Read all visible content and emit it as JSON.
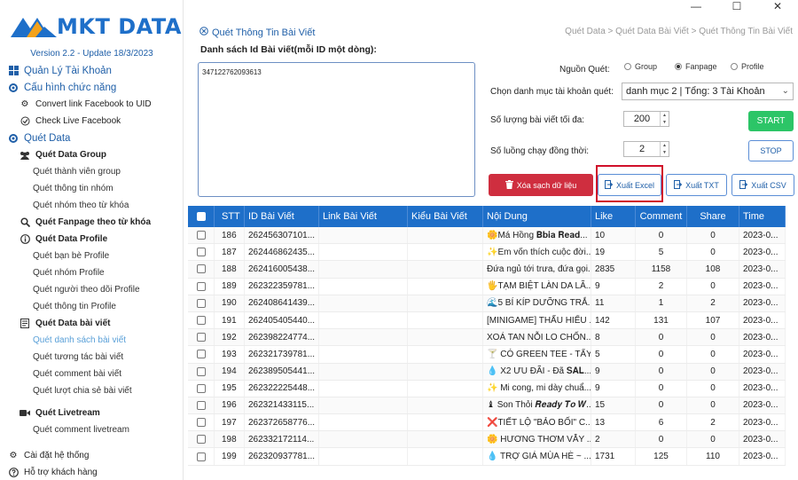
{
  "window": {
    "minimize": "—",
    "maximize": "☐",
    "close": "✕"
  },
  "brand": {
    "name": "MKT DATA",
    "version": "Version 2.2 - Update 18/3/2023"
  },
  "sidebar": {
    "items": [
      {
        "label": "Quản Lý Tài Khoản",
        "icon": "account-icon"
      },
      {
        "label": "Cấu hình chức năng",
        "icon": "config-icon"
      },
      {
        "label": "Convert link Facebook to UID",
        "icon": "gear-icon"
      },
      {
        "label": "Check Live Facebook",
        "icon": "check-icon"
      },
      {
        "label": "Quét Data",
        "icon": "config-icon"
      },
      {
        "label": "Quét Data Group",
        "icon": "group-icon"
      },
      {
        "label": "Quét thành viên group"
      },
      {
        "label": "Quét thông tin nhóm"
      },
      {
        "label": "Quét nhóm theo từ khóa"
      },
      {
        "label": "Quét Fanpage theo từ khóa",
        "icon": "search-icon"
      },
      {
        "label": "Quét Data Profile",
        "icon": "info-icon"
      },
      {
        "label": "Quét bạn bè Profile"
      },
      {
        "label": "Quét nhóm Profile"
      },
      {
        "label": "Quét người theo dõi Profile"
      },
      {
        "label": "Quét thông tin Profile"
      },
      {
        "label": "Quét Data bài viết",
        "icon": "document-icon"
      },
      {
        "label": "Quét danh sách bài viết",
        "active": true
      },
      {
        "label": "Quét tương tác bài viết"
      },
      {
        "label": "Quét comment bài viết"
      },
      {
        "label": "Quét lượt chia sẻ bài viết"
      },
      {
        "label": "Quét Livetream",
        "icon": "video-icon"
      },
      {
        "label": "Quét comment livetream"
      }
    ],
    "bottom": [
      {
        "label": "Cài đặt hệ thống",
        "icon": "gear-icon"
      },
      {
        "label": "Hỗ trợ khách hàng",
        "icon": "support-icon"
      }
    ]
  },
  "header": {
    "title": "Quét Thông Tin Bài Viết",
    "breadcrumb": "Quét Data > Quét Data Bài Viết > Quét Thông Tin Bài Viết"
  },
  "form": {
    "id_list_label": "Danh sách Id Bài viết(mỗi ID một dòng):",
    "id_list_value": "347122762093613",
    "source_label": "Nguồn Quét:",
    "source_options": [
      "Group",
      "Fanpage",
      "Profile"
    ],
    "source_selected": "Fanpage",
    "account_label": "Chọn danh mục tài khoản quét:",
    "account_value": "danh mục 2 | Tổng: 3 Tài Khoản",
    "max_posts_label": "Số lượng bài viết tối đa:",
    "max_posts_value": "200",
    "threads_label": "Số luồng chạy đồng thời:",
    "threads_value": "2"
  },
  "buttons": {
    "start": "START",
    "stop": "STOP",
    "clear": "Xóa sạch dữ liệu",
    "export_excel": "Xuất Excel",
    "export_txt": "Xuất TXT",
    "export_csv": "Xuất CSV"
  },
  "table": {
    "columns": [
      "STT",
      "ID Bài Viết",
      "Link Bài Viết",
      "Kiểu Bài Viết",
      "Nội Dung",
      "Like",
      "Comment",
      "Share",
      "Time"
    ],
    "rows": [
      {
        "stt": "186",
        "id": "262456307101...",
        "link": "",
        "kind": "",
        "content": "🌼Má Hồng 𝐁𝐛𝐢𝐚 𝐑𝐞𝐚𝐝...",
        "like": "10",
        "comment": "0",
        "share": "0",
        "time": "2023-0..."
      },
      {
        "stt": "187",
        "id": "262446862435...",
        "link": "",
        "kind": "",
        "content": "✨Em vốn thích cuộc đời...",
        "like": "19",
        "comment": "5",
        "share": "0",
        "time": "2023-0..."
      },
      {
        "stt": "188",
        "id": "262416005438...",
        "link": "",
        "kind": "",
        "content": "Đứa ngủ tới trưa, đứa gọi...",
        "like": "2835",
        "comment": "1158",
        "share": "108",
        "time": "2023-0..."
      },
      {
        "stt": "189",
        "id": "262322359781...",
        "link": "",
        "kind": "",
        "content": "🖐TẠM BIỆT LÀN DA LÃ...",
        "like": "9",
        "comment": "2",
        "share": "0",
        "time": "2023-0..."
      },
      {
        "stt": "190",
        "id": "262408641439...",
        "link": "",
        "kind": "",
        "content": "🌊5 BÍ KÍP DƯỠNG TRẮ...",
        "like": "11",
        "comment": "1",
        "share": "2",
        "time": "2023-0..."
      },
      {
        "stt": "191",
        "id": "262405405440...",
        "link": "",
        "kind": "",
        "content": "[MINIGAME] THẤU HIỂU ...",
        "like": "142",
        "comment": "131",
        "share": "107",
        "time": "2023-0..."
      },
      {
        "stt": "192",
        "id": "262398224774...",
        "link": "",
        "kind": "",
        "content": "XOÁ TAN NỖI LO CHỐN...",
        "like": "8",
        "comment": "0",
        "share": "0",
        "time": "2023-0..."
      },
      {
        "stt": "193",
        "id": "262321739781...",
        "link": "",
        "kind": "",
        "content": "🍸 CÓ GREEN TEE - TẨY ...",
        "like": "5",
        "comment": "0",
        "share": "0",
        "time": "2023-0..."
      },
      {
        "stt": "194",
        "id": "262389505441...",
        "link": "",
        "kind": "",
        "content": "💧 X2 ƯU ĐÃI - Đã 𝐒𝐀𝐋...",
        "like": "9",
        "comment": "0",
        "share": "0",
        "time": "2023-0..."
      },
      {
        "stt": "195",
        "id": "262322225448...",
        "link": "",
        "kind": "",
        "content": "✨ Mi cong, mi dày chuẩ...",
        "like": "9",
        "comment": "0",
        "share": "0",
        "time": "2023-0..."
      },
      {
        "stt": "196",
        "id": "262321433115...",
        "link": "",
        "kind": "",
        "content": "♝ Son Thỏi 𝑹𝒆𝒂𝒅𝒚 𝑻𝒐 𝑾...",
        "like": "15",
        "comment": "0",
        "share": "0",
        "time": "2023-0..."
      },
      {
        "stt": "197",
        "id": "262372658776...",
        "link": "",
        "kind": "",
        "content": "❌TIẾT LỘ \"BẢO BỐI\" C...",
        "like": "13",
        "comment": "6",
        "share": "2",
        "time": "2023-0..."
      },
      {
        "stt": "198",
        "id": "262332172114...",
        "link": "",
        "kind": "",
        "content": "🌼 HƯƠNG THƠM VẪY ...",
        "like": "2",
        "comment": "0",
        "share": "0",
        "time": "2023-0..."
      },
      {
        "stt": "199",
        "id": "262320937781...",
        "link": "",
        "kind": "",
        "content": "💧 TRỢ GIÁ MÙA HÈ ~ ...",
        "like": "1731",
        "comment": "125",
        "share": "110",
        "time": "2023-0..."
      }
    ]
  }
}
